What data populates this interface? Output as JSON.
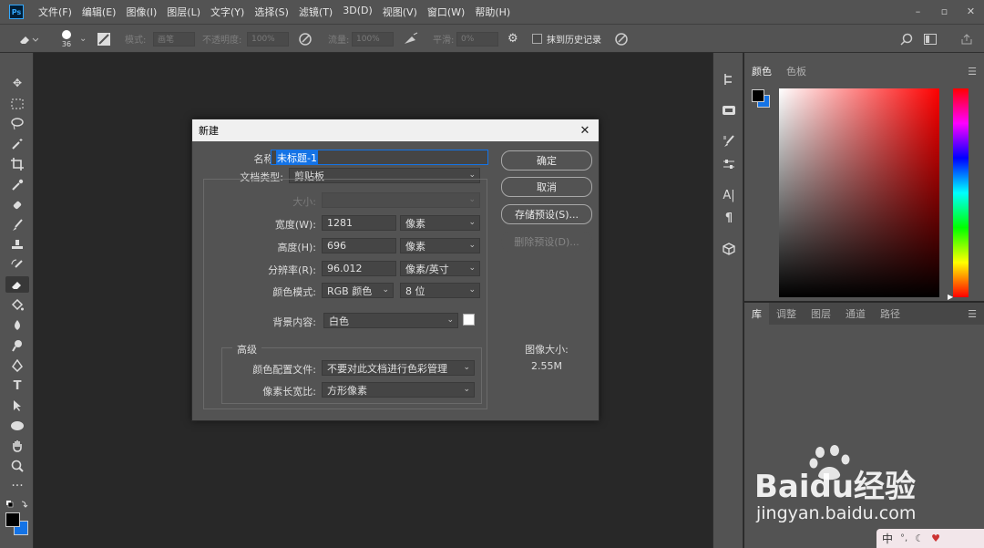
{
  "app": {
    "logo": "Ps"
  },
  "menu": [
    "文件(F)",
    "编辑(E)",
    "图像(I)",
    "图层(L)",
    "文字(Y)",
    "选择(S)",
    "滤镜(T)",
    "3D(D)",
    "视图(V)",
    "窗口(W)",
    "帮助(H)"
  ],
  "window_controls": {
    "minimize": "–",
    "restore": "▫",
    "close": "✕"
  },
  "options_bar": {
    "brush_size": "36",
    "mode_label": "模式:",
    "mode_value": "画笔",
    "opacity_label": "不透明度:",
    "opacity_value": "100%",
    "flow_label": "流量:",
    "flow_value": "100%",
    "smooth_label": "平滑:",
    "smooth_value": "0%",
    "erase_history_label": "抹到历史记录"
  },
  "panels": {
    "color_tabs": [
      "颜色",
      "色板"
    ],
    "library_tabs": [
      "库",
      "调整",
      "图层",
      "通道",
      "路径"
    ],
    "colors": {
      "foreground": "#000000",
      "background": "#1473e6"
    }
  },
  "dialog": {
    "title": "新建",
    "name_label": "名称(N):",
    "name_value": "未标题-1",
    "doctype_label": "文档类型:",
    "doctype_value": "剪贴板",
    "size_label": "大小:",
    "width_label": "宽度(W):",
    "width_value": "1281",
    "width_unit": "像素",
    "height_label": "高度(H):",
    "height_value": "696",
    "height_unit": "像素",
    "resolution_label": "分辨率(R):",
    "resolution_value": "96.012",
    "resolution_unit": "像素/英寸",
    "color_mode_label": "颜色模式:",
    "color_mode_value": "RGB 颜色",
    "bit_depth_value": "8 位",
    "bg_label": "背景内容:",
    "bg_value": "白色",
    "advanced_label": "高级",
    "profile_label": "颜色配置文件:",
    "profile_value": "不要对此文档进行色彩管理",
    "pixel_aspect_label": "像素长宽比:",
    "pixel_aspect_value": "方形像素",
    "ok_button": "确定",
    "cancel_button": "取消",
    "save_preset_button": "存储预设(S)...",
    "delete_preset_button": "删除预设(D)...",
    "image_size_label": "图像大小:",
    "image_size_value": "2.55M"
  },
  "watermark": {
    "brand": "Baidu经验",
    "url": "jingyan.baidu.com"
  },
  "ime": "中"
}
